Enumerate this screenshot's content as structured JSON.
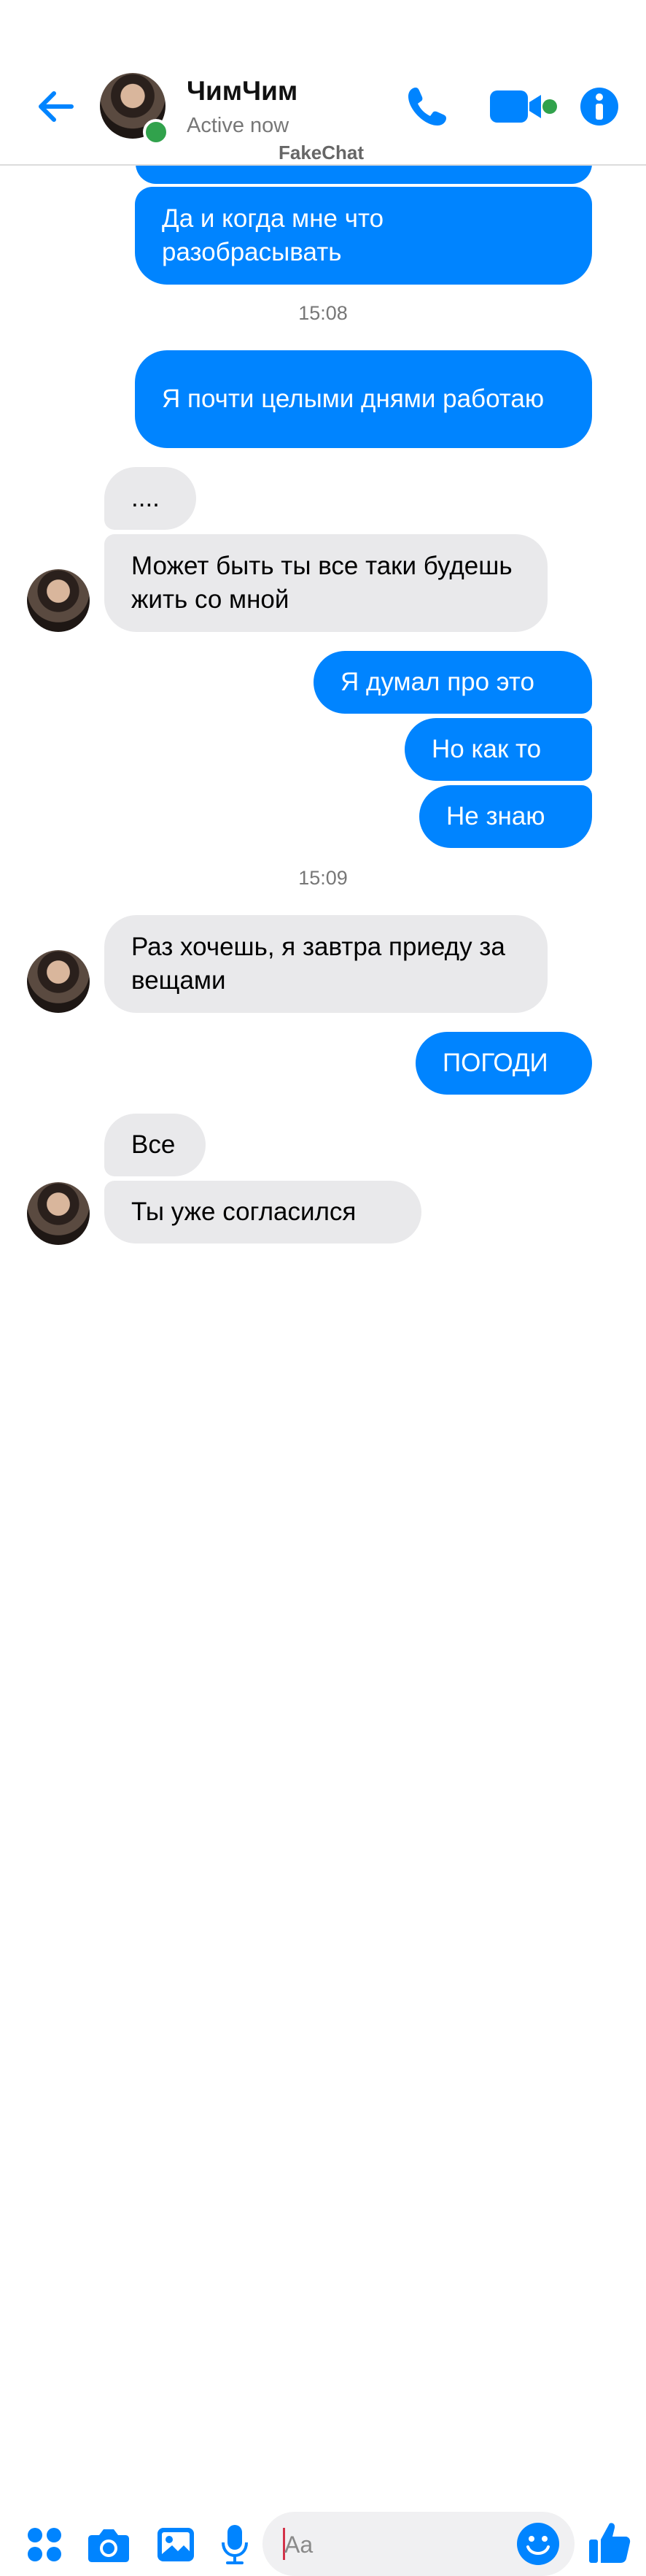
{
  "header": {
    "contact_name": "ЧимЧим",
    "status": "Active now",
    "watermark": "FakeChat",
    "icons": [
      "back-arrow-icon",
      "phone-icon",
      "video-camera-icon",
      "info-icon"
    ]
  },
  "messages": [
    {
      "side": "out",
      "text": ""
    },
    {
      "side": "out",
      "text": "Да и когда мне что разобрасывать"
    },
    {
      "timestamp": "15:08"
    },
    {
      "side": "out",
      "text": "Я почти целыми днями работаю"
    },
    {
      "side": "in",
      "text": "...."
    },
    {
      "side": "in",
      "text": "Может быть ты все таки будешь жить со мной"
    },
    {
      "side": "out",
      "text": "Я думал про это"
    },
    {
      "side": "out",
      "text": "Но как то"
    },
    {
      "side": "out",
      "text": "Не знаю"
    },
    {
      "timestamp": "15:09"
    },
    {
      "side": "in",
      "text": "Раз хочешь, я завтра приеду за вещами"
    },
    {
      "side": "out",
      "text": "ПОГОДИ"
    },
    {
      "side": "in",
      "text": "Все"
    },
    {
      "side": "in",
      "text": "Ты уже согласился"
    }
  ],
  "composer": {
    "placeholder": "Aa",
    "icons": [
      "apps-icon",
      "camera-icon",
      "gallery-icon",
      "microphone-icon",
      "emoji-icon",
      "like-icon"
    ]
  },
  "colors": {
    "accent": "#0084ff",
    "incoming_bubble": "#e9e9eb",
    "online": "#31a24c"
  }
}
